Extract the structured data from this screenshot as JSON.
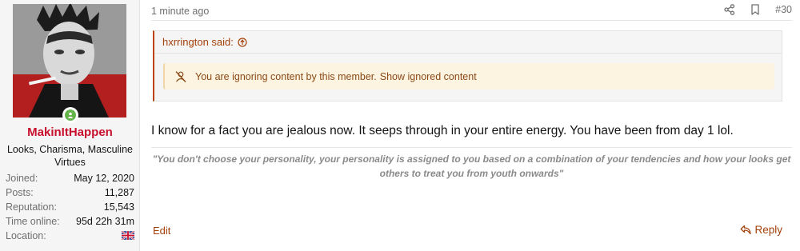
{
  "user": {
    "username": "MakinItHappen",
    "title": "Looks, Charisma, Masculine Virtues",
    "stats": [
      {
        "label": "Joined:",
        "value": "May 12, 2020"
      },
      {
        "label": "Posts:",
        "value": "11,287"
      },
      {
        "label": "Reputation:",
        "value": "15,543"
      },
      {
        "label": "Time online:",
        "value": "95d 22h 31m"
      }
    ],
    "location_label": "Location:",
    "location_flag": "uk-flag-icon"
  },
  "post": {
    "time": "1 minute ago",
    "number": "#30",
    "quote_author": "hxrrington said:",
    "ignored_text": "You are ignoring content by this member.",
    "ignored_link": "Show ignored content",
    "message": "I know for a fact you are jealous now. It seeps through in your entire energy. You have been from day 1 lol.",
    "signature": "\"You don't choose your personality, your personality is assigned to you based on a combination of your tendencies and how your looks get others to treat you from youth onwards\"",
    "edit_label": "Edit",
    "reply_label": "Reply"
  },
  "colors": {
    "accent": "#a3410b",
    "username": "#c8102e",
    "online": "#63b549",
    "ignored_bg": "#fdf3e1"
  }
}
